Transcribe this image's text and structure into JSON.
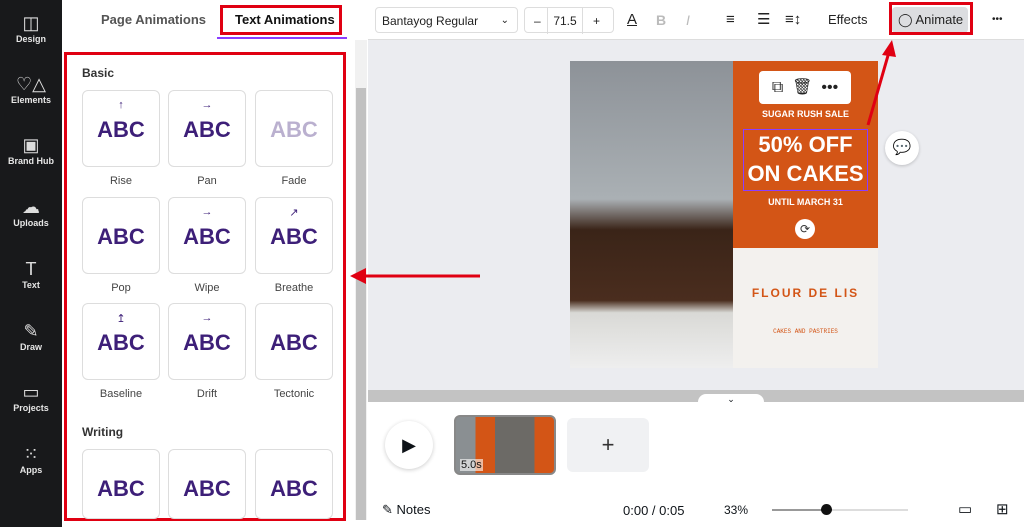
{
  "sidebar": {
    "items": [
      {
        "label": "Design",
        "icon": "layout-icon"
      },
      {
        "label": "Elements",
        "icon": "shapes-icon"
      },
      {
        "label": "Brand Hub",
        "icon": "brand-icon"
      },
      {
        "label": "Uploads",
        "icon": "cloud-upload-icon"
      },
      {
        "label": "Text",
        "icon": "text-icon"
      },
      {
        "label": "Draw",
        "icon": "pen-icon"
      },
      {
        "label": "Projects",
        "icon": "folder-icon"
      },
      {
        "label": "Apps",
        "icon": "grid-icon"
      }
    ]
  },
  "panel": {
    "tabs": [
      "Page Animations",
      "Text Animations"
    ],
    "active_tab": "Text Animations",
    "sections": [
      {
        "title": "Basic",
        "items": [
          {
            "label": "Rise",
            "preview": "ABC",
            "arrow": "↑"
          },
          {
            "label": "Pan",
            "preview": "ABC",
            "arrow": "→"
          },
          {
            "label": "Fade",
            "preview": "ABC",
            "arrow": ""
          },
          {
            "label": "Pop",
            "preview": "ABC",
            "arrow": ""
          },
          {
            "label": "Wipe",
            "preview": "ABC",
            "arrow": "→"
          },
          {
            "label": "Breathe",
            "preview": "ABC",
            "arrow": "↗"
          },
          {
            "label": "Baseline",
            "preview": "ABC",
            "arrow": "↥"
          },
          {
            "label": "Drift",
            "preview": "ABC",
            "arrow": "→"
          },
          {
            "label": "Tectonic",
            "preview": "ABC",
            "arrow": ""
          }
        ]
      },
      {
        "title": "Writing",
        "items": [
          {
            "preview": "ABC"
          },
          {
            "preview": "ABC"
          },
          {
            "preview": "ABC"
          }
        ]
      }
    ]
  },
  "toolbar": {
    "font": "Bantayog Regular",
    "size": "71.5",
    "minus": "–",
    "plus": "+",
    "bold": "B",
    "italic": "I",
    "color": "A",
    "effects": "Effects",
    "animate": "Animate",
    "more": "•••"
  },
  "design": {
    "tagline_top": "SUGAR RUSH SALE",
    "headline1": "50% OFF",
    "headline2": "ON CAKES",
    "tagline_bottom": "UNTIL MARCH 31",
    "brand": "FLOUR DE LIS",
    "brand_sub": "CAKES AND PASTRIES",
    "orange": "#d35516",
    "cream": "#f3f1ee"
  },
  "timeline": {
    "duration_badge": "5.0s",
    "add": "+",
    "notes": "Notes",
    "time": "0:00 / 0:05",
    "zoom": "33%",
    "zoom_value": 33
  }
}
